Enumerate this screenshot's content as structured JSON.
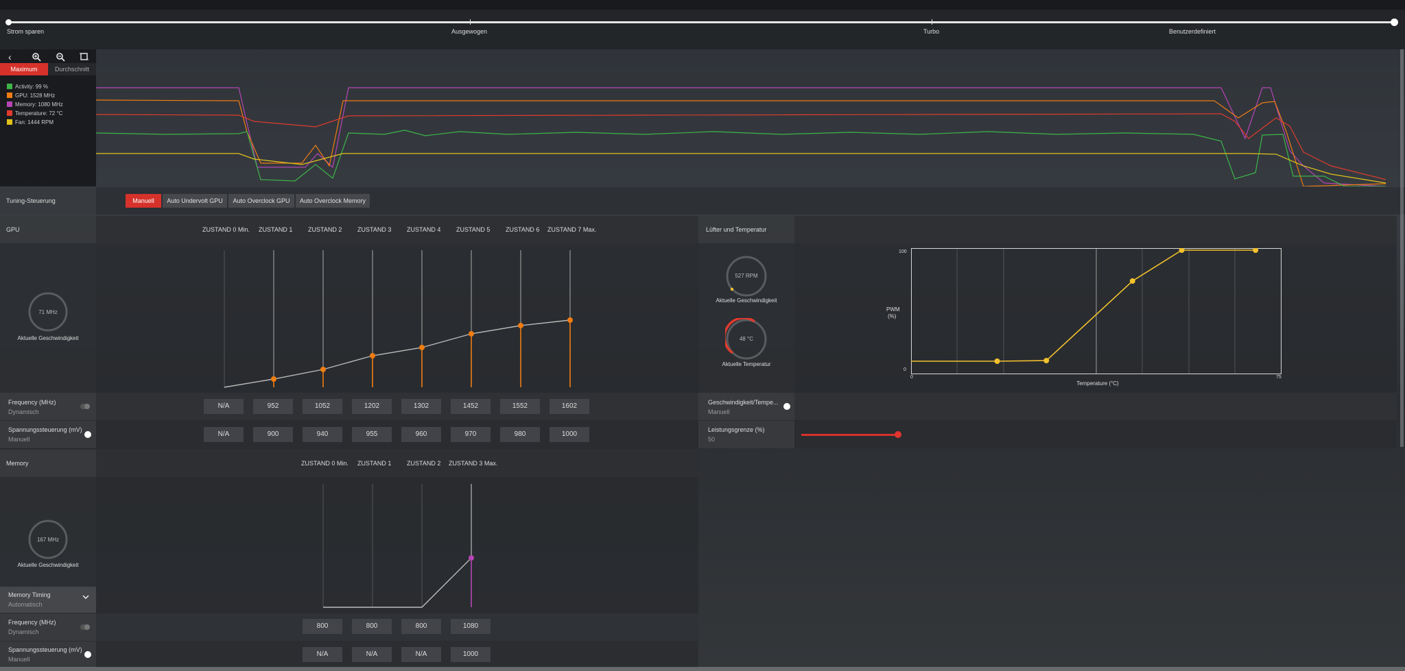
{
  "profiles": {
    "items": [
      "Strom sparen",
      "Ausgewogen",
      "Turbo",
      "Benutzerdefiniert"
    ]
  },
  "monitor": {
    "tabs": [
      "Maximum",
      "Durchschnitt"
    ],
    "legend": [
      {
        "label": "Activity: 99 %",
        "color": "#3cb54a"
      },
      {
        "label": "GPU: 1528 MHz",
        "color": "#f07c12"
      },
      {
        "label": "Memory: 1080 MHz",
        "color": "#b545b5"
      },
      {
        "label": "Temperature: 72 °C",
        "color": "#e03a2e"
      },
      {
        "label": "Fan: 1444 RPM",
        "color": "#e2c21a"
      }
    ]
  },
  "tuning": {
    "label": "Tuning-Steuerung",
    "buttons": [
      "Manuell",
      "Auto Undervolt GPU",
      "Auto Overclock GPU",
      "Auto Overclock Memory"
    ],
    "active": "Manuell"
  },
  "gpu": {
    "title": "GPU",
    "states": [
      "ZUSTAND 0 Min.",
      "ZUSTAND 1",
      "ZUSTAND 2",
      "ZUSTAND 3",
      "ZUSTAND 4",
      "ZUSTAND 5",
      "ZUSTAND 6",
      "ZUSTAND 7 Max."
    ],
    "gauge_value": "71 MHz",
    "gauge_label": "Aktuelle Geschwindigkeit",
    "frequency": {
      "label": "Frequency (MHz)",
      "sub": "Dynamisch",
      "values": [
        "N/A",
        "952",
        "1052",
        "1202",
        "1302",
        "1452",
        "1552",
        "1602"
      ]
    },
    "voltage": {
      "label": "Spannungssteuerung (mV)",
      "sub": "Manuell",
      "values": [
        "N/A",
        "900",
        "940",
        "955",
        "960",
        "970",
        "980",
        "1000"
      ]
    },
    "curve_levels": [
      0.0,
      0.06,
      0.13,
      0.23,
      0.29,
      0.39,
      0.45,
      0.49
    ]
  },
  "memory": {
    "title": "Memory",
    "states": [
      "ZUSTAND 0 Min.",
      "ZUSTAND 1",
      "ZUSTAND 2",
      "ZUSTAND 3 Max."
    ],
    "gauge_value": "167 MHz",
    "gauge_label": "Aktuelle Geschwindigkeit",
    "timing": {
      "label": "Memory Timing",
      "sub": "Automatisch"
    },
    "frequency": {
      "label": "Frequency (MHz)",
      "sub": "Dynamisch",
      "values": [
        "800",
        "800",
        "800",
        "1080"
      ]
    },
    "voltage": {
      "label": "Spannungssteuerung (mV)",
      "sub": "Manuell",
      "values": [
        "N/A",
        "N/A",
        "N/A",
        "1000"
      ]
    }
  },
  "fan": {
    "title": "Lüfter und Temperatur",
    "speed_value": "527 RPM",
    "speed_label": "Aktuelle Geschwindigkeit",
    "temp_value": "48 °C",
    "temp_label": "Aktuelle Temperatur",
    "chart_ylabel_1": "PWM",
    "chart_ylabel_2": "(%)",
    "chart_xlabel": "Temperature (°C)",
    "y_max": "100",
    "y_min": "0",
    "x_min": "0",
    "x_max": "75",
    "speed_temp": {
      "label": "Geschwindigkeit/Tempe...",
      "sub": "Manuell"
    },
    "power_limit": {
      "label": "Leistungsgrenze (%)",
      "value": "50"
    }
  },
  "chart_data": [
    {
      "type": "line",
      "title": "",
      "x": [
        0,
        17.5,
        27.5,
        45,
        55,
        70
      ],
      "series": [
        {
          "values": [
            10,
            10,
            10.5,
            75,
            100,
            100
          ]
        }
      ],
      "xlabel": "Temperature (°C)",
      "ylabel": "PWM (%)",
      "xlim": [
        0,
        75
      ],
      "ylim": [
        0,
        100
      ],
      "grid": true,
      "color": "#f2c12e"
    }
  ]
}
